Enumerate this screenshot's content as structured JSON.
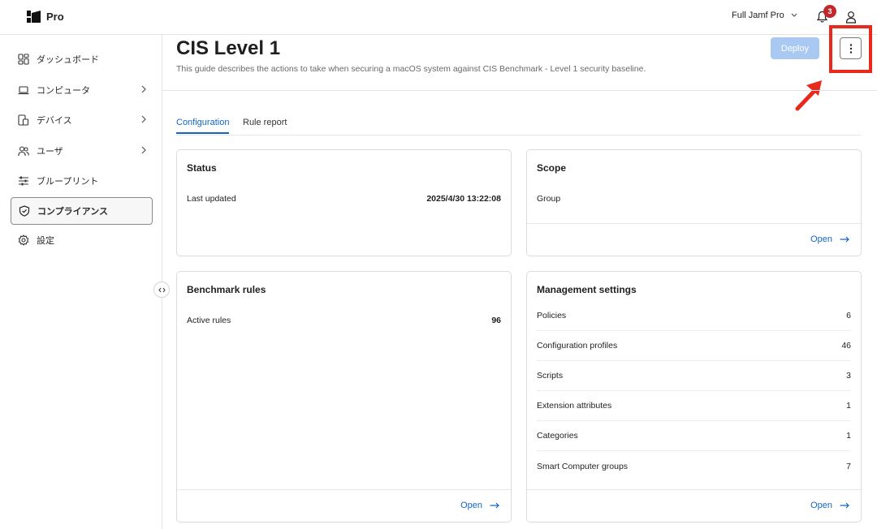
{
  "topbar": {
    "logo_text": "Pro",
    "environment": "Full Jamf Pro",
    "notification_count": "3"
  },
  "sidebar": {
    "items": [
      {
        "label": "ダッシュボード",
        "icon": "dashboard-icon"
      },
      {
        "label": "コンピュータ",
        "icon": "laptop-icon",
        "has_children": true
      },
      {
        "label": "デバイス",
        "icon": "devices-icon",
        "has_children": true
      },
      {
        "label": "ユーザ",
        "icon": "users-icon",
        "has_children": true
      },
      {
        "label": "ブループリント",
        "icon": "sliders-icon"
      },
      {
        "label": "コンプライアンス",
        "icon": "shield-check-icon",
        "active": true
      },
      {
        "label": "設定",
        "icon": "gear-icon"
      }
    ]
  },
  "header": {
    "title": "CIS Level 1",
    "description": "This guide describes the actions to take when securing a macOS system against CIS Benchmark - Level 1 security baseline.",
    "deploy_label": "Deploy"
  },
  "tabs": [
    {
      "label": "Configuration",
      "active": true
    },
    {
      "label": "Rule report",
      "active": false
    }
  ],
  "status_card": {
    "title": "Status",
    "last_updated_label": "Last updated",
    "last_updated_value": "2025/4/30 13:22:08"
  },
  "scope_card": {
    "title": "Scope",
    "group_label": "Group",
    "open_label": "Open"
  },
  "benchmark_card": {
    "title": "Benchmark rules",
    "active_rules_label": "Active rules",
    "active_rules_value": "96",
    "open_label": "Open"
  },
  "management_card": {
    "title": "Management settings",
    "rows": [
      {
        "label": "Policies",
        "value": "6"
      },
      {
        "label": "Configuration profiles",
        "value": "46"
      },
      {
        "label": "Scripts",
        "value": "3"
      },
      {
        "label": "Extension attributes",
        "value": "1"
      },
      {
        "label": "Categories",
        "value": "1"
      },
      {
        "label": "Smart Computer groups",
        "value": "7"
      }
    ],
    "open_label": "Open"
  },
  "colors": {
    "accent": "#1565c0",
    "deploy_disabled": "#a9c8f2",
    "badge": "#c1272d",
    "highlight": "#e8291c"
  }
}
